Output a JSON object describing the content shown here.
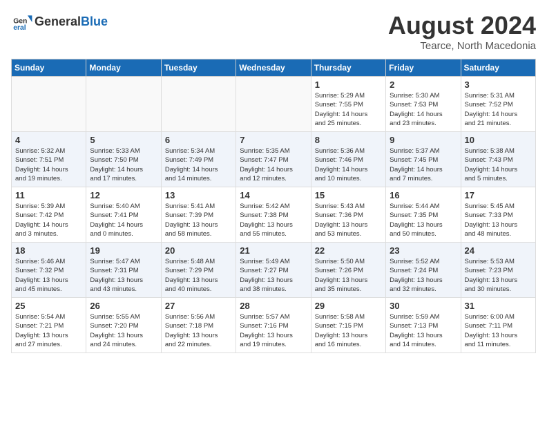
{
  "header": {
    "logo_line1": "General",
    "logo_line2": "Blue",
    "month": "August 2024",
    "location": "Tearce, North Macedonia"
  },
  "days_of_week": [
    "Sunday",
    "Monday",
    "Tuesday",
    "Wednesday",
    "Thursday",
    "Friday",
    "Saturday"
  ],
  "weeks": [
    [
      {
        "num": "",
        "info": "",
        "empty": true
      },
      {
        "num": "",
        "info": "",
        "empty": true
      },
      {
        "num": "",
        "info": "",
        "empty": true
      },
      {
        "num": "",
        "info": "",
        "empty": true
      },
      {
        "num": "1",
        "info": "Sunrise: 5:29 AM\nSunset: 7:55 PM\nDaylight: 14 hours\nand 25 minutes.",
        "empty": false
      },
      {
        "num": "2",
        "info": "Sunrise: 5:30 AM\nSunset: 7:53 PM\nDaylight: 14 hours\nand 23 minutes.",
        "empty": false
      },
      {
        "num": "3",
        "info": "Sunrise: 5:31 AM\nSunset: 7:52 PM\nDaylight: 14 hours\nand 21 minutes.",
        "empty": false
      }
    ],
    [
      {
        "num": "4",
        "info": "Sunrise: 5:32 AM\nSunset: 7:51 PM\nDaylight: 14 hours\nand 19 minutes.",
        "empty": false
      },
      {
        "num": "5",
        "info": "Sunrise: 5:33 AM\nSunset: 7:50 PM\nDaylight: 14 hours\nand 17 minutes.",
        "empty": false
      },
      {
        "num": "6",
        "info": "Sunrise: 5:34 AM\nSunset: 7:49 PM\nDaylight: 14 hours\nand 14 minutes.",
        "empty": false
      },
      {
        "num": "7",
        "info": "Sunrise: 5:35 AM\nSunset: 7:47 PM\nDaylight: 14 hours\nand 12 minutes.",
        "empty": false
      },
      {
        "num": "8",
        "info": "Sunrise: 5:36 AM\nSunset: 7:46 PM\nDaylight: 14 hours\nand 10 minutes.",
        "empty": false
      },
      {
        "num": "9",
        "info": "Sunrise: 5:37 AM\nSunset: 7:45 PM\nDaylight: 14 hours\nand 7 minutes.",
        "empty": false
      },
      {
        "num": "10",
        "info": "Sunrise: 5:38 AM\nSunset: 7:43 PM\nDaylight: 14 hours\nand 5 minutes.",
        "empty": false
      }
    ],
    [
      {
        "num": "11",
        "info": "Sunrise: 5:39 AM\nSunset: 7:42 PM\nDaylight: 14 hours\nand 3 minutes.",
        "empty": false
      },
      {
        "num": "12",
        "info": "Sunrise: 5:40 AM\nSunset: 7:41 PM\nDaylight: 14 hours\nand 0 minutes.",
        "empty": false
      },
      {
        "num": "13",
        "info": "Sunrise: 5:41 AM\nSunset: 7:39 PM\nDaylight: 13 hours\nand 58 minutes.",
        "empty": false
      },
      {
        "num": "14",
        "info": "Sunrise: 5:42 AM\nSunset: 7:38 PM\nDaylight: 13 hours\nand 55 minutes.",
        "empty": false
      },
      {
        "num": "15",
        "info": "Sunrise: 5:43 AM\nSunset: 7:36 PM\nDaylight: 13 hours\nand 53 minutes.",
        "empty": false
      },
      {
        "num": "16",
        "info": "Sunrise: 5:44 AM\nSunset: 7:35 PM\nDaylight: 13 hours\nand 50 minutes.",
        "empty": false
      },
      {
        "num": "17",
        "info": "Sunrise: 5:45 AM\nSunset: 7:33 PM\nDaylight: 13 hours\nand 48 minutes.",
        "empty": false
      }
    ],
    [
      {
        "num": "18",
        "info": "Sunrise: 5:46 AM\nSunset: 7:32 PM\nDaylight: 13 hours\nand 45 minutes.",
        "empty": false
      },
      {
        "num": "19",
        "info": "Sunrise: 5:47 AM\nSunset: 7:31 PM\nDaylight: 13 hours\nand 43 minutes.",
        "empty": false
      },
      {
        "num": "20",
        "info": "Sunrise: 5:48 AM\nSunset: 7:29 PM\nDaylight: 13 hours\nand 40 minutes.",
        "empty": false
      },
      {
        "num": "21",
        "info": "Sunrise: 5:49 AM\nSunset: 7:27 PM\nDaylight: 13 hours\nand 38 minutes.",
        "empty": false
      },
      {
        "num": "22",
        "info": "Sunrise: 5:50 AM\nSunset: 7:26 PM\nDaylight: 13 hours\nand 35 minutes.",
        "empty": false
      },
      {
        "num": "23",
        "info": "Sunrise: 5:52 AM\nSunset: 7:24 PM\nDaylight: 13 hours\nand 32 minutes.",
        "empty": false
      },
      {
        "num": "24",
        "info": "Sunrise: 5:53 AM\nSunset: 7:23 PM\nDaylight: 13 hours\nand 30 minutes.",
        "empty": false
      }
    ],
    [
      {
        "num": "25",
        "info": "Sunrise: 5:54 AM\nSunset: 7:21 PM\nDaylight: 13 hours\nand 27 minutes.",
        "empty": false
      },
      {
        "num": "26",
        "info": "Sunrise: 5:55 AM\nSunset: 7:20 PM\nDaylight: 13 hours\nand 24 minutes.",
        "empty": false
      },
      {
        "num": "27",
        "info": "Sunrise: 5:56 AM\nSunset: 7:18 PM\nDaylight: 13 hours\nand 22 minutes.",
        "empty": false
      },
      {
        "num": "28",
        "info": "Sunrise: 5:57 AM\nSunset: 7:16 PM\nDaylight: 13 hours\nand 19 minutes.",
        "empty": false
      },
      {
        "num": "29",
        "info": "Sunrise: 5:58 AM\nSunset: 7:15 PM\nDaylight: 13 hours\nand 16 minutes.",
        "empty": false
      },
      {
        "num": "30",
        "info": "Sunrise: 5:59 AM\nSunset: 7:13 PM\nDaylight: 13 hours\nand 14 minutes.",
        "empty": false
      },
      {
        "num": "31",
        "info": "Sunrise: 6:00 AM\nSunset: 7:11 PM\nDaylight: 13 hours\nand 11 minutes.",
        "empty": false
      }
    ]
  ]
}
